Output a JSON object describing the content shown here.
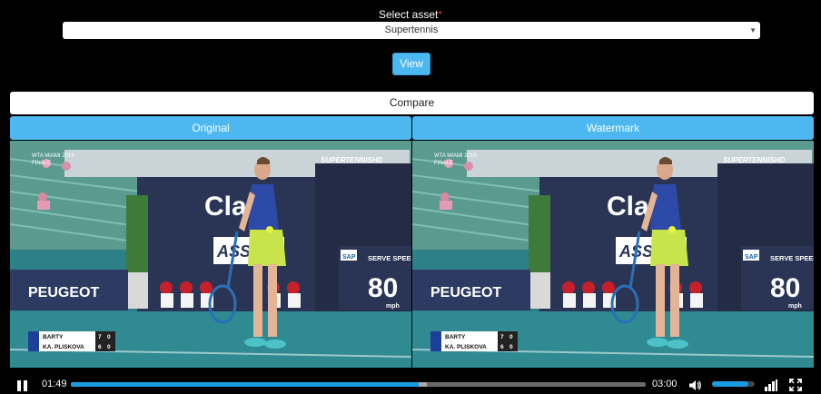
{
  "form": {
    "select_label": "Select asset",
    "required_mark": "*",
    "selected_asset": "Supertennis",
    "view_label": "View"
  },
  "compare": {
    "label": "Compare",
    "tabs": [
      {
        "label": "Original"
      },
      {
        "label": "Watermark"
      }
    ]
  },
  "video": {
    "broadcast_logo": "SUPERTENNISHD",
    "tournament_line1": "WTA MIAMI 2019",
    "tournament_line2": "FINALE",
    "sponsor_1": "Clar",
    "sponsor_2": "PEUGEOT",
    "sponsor_3": "ASS",
    "speed_brand": "SAP",
    "speed_title": "SERVE SPEED",
    "speed_value": "80",
    "speed_unit": "mph",
    "score": [
      {
        "player": "BARTY",
        "set": "7",
        "game": "0"
      },
      {
        "player": "KA. PLISKOVA",
        "set": "6",
        "game": "0"
      }
    ]
  },
  "player": {
    "current_time": "01:49",
    "total_time": "03:00",
    "progress": 0.605,
    "buffered": 0.015,
    "volume": 0.85
  },
  "colors": {
    "accent": "#4db8f0",
    "progress": "#1a9be0",
    "required": "#e03030"
  }
}
